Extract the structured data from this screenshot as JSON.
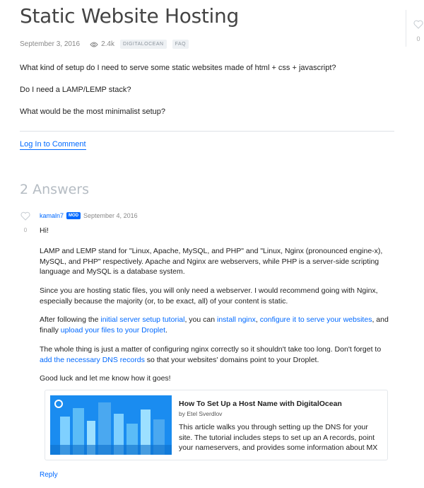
{
  "question": {
    "title": "Static Website Hosting",
    "date": "September 3, 2016",
    "views": "2.4k",
    "tags": [
      "DIGITALOCEAN",
      "FAQ"
    ],
    "body": [
      "What kind of setup do I need to serve some static websites made of html + css + javascript?",
      "Do I need a LAMP/LEMP stack?",
      "What would be the most minimalist setup?"
    ],
    "login_link": "Log In to Comment",
    "like_count": "0"
  },
  "answers_heading": "2 Answers",
  "answer": {
    "author": "kamaln7",
    "badge": "MOD",
    "date": "September 4, 2016",
    "vote_count": "0",
    "greeting": "Hi!",
    "p1": "LAMP and LEMP stand for \"Linux, Apache, MySQL, and PHP\" and \"Linux, Nginx (pronounced engine-x), MySQL, and PHP\" respectively. Apache and Nginx are webservers, while PHP is a server-side scripting language and MySQL is a database system.",
    "p2": "Since you are hosting static files, you will only need a webserver. I would recommend going with Nginx, especially because the majority (or, to be exact, all) of your content is static.",
    "p3": {
      "t1": "After following the ",
      "l1": "initial server setup tutorial",
      "t2": ", you can ",
      "l2": "install nginx",
      "t3": ", ",
      "l3": "configure it to serve your websites",
      "t4": ", and finally ",
      "l4": "upload your files to your Droplet",
      "t5": "."
    },
    "p4": {
      "t1": "The whole thing is just a matter of configuring nginx correctly so it shouldn't take too long. Don't forget to ",
      "l1": "add the necessary DNS records",
      "t2": " so that your websites' domains point to your Droplet."
    },
    "p5": "Good luck and let me know how it goes!",
    "card": {
      "title": "How To Set Up a Host Name with DigitalOcean",
      "author": "by Etel Sverdlov",
      "description": "This article walks you through setting up the DNS for your site. The tutorial includes steps to set up an A records, point your nameservers, and provides some information about MX"
    },
    "reply": "Reply"
  },
  "colors": {
    "link": "#0069ff",
    "badge": "#0069ff",
    "card_image_bg": "#1a8cf0"
  }
}
